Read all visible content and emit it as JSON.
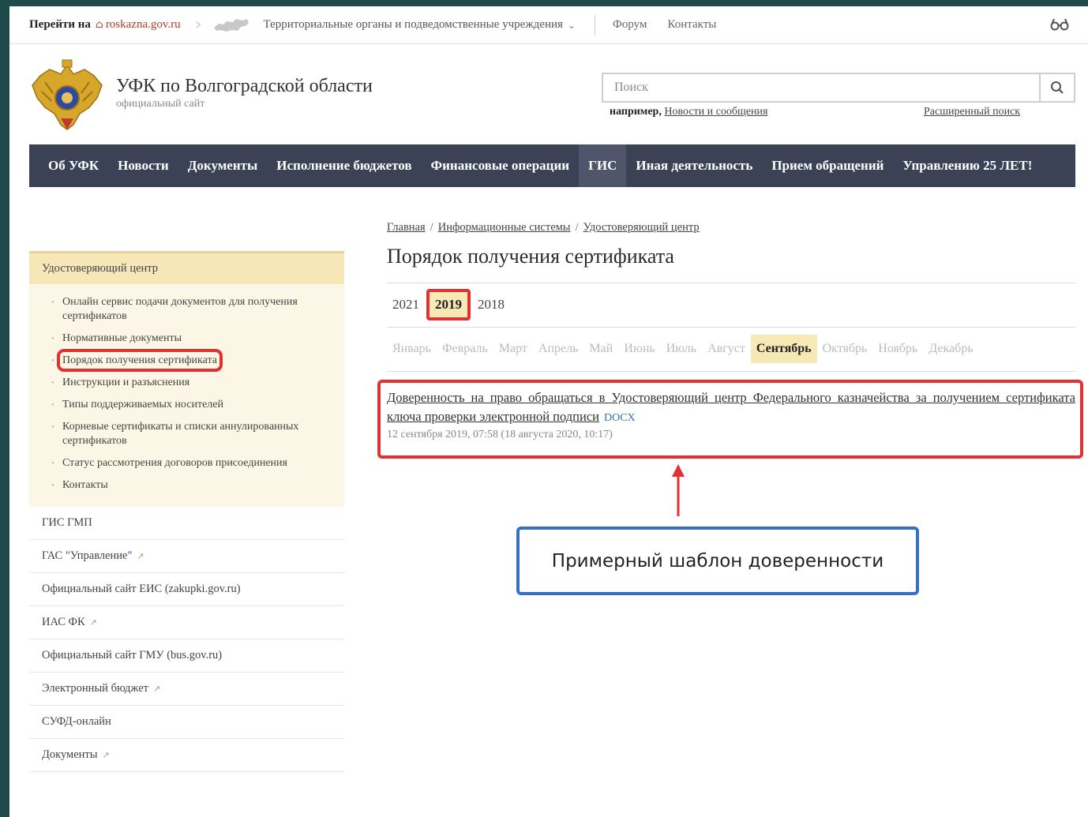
{
  "topbar": {
    "goto_label": "Перейти на",
    "roskazna": "roskazna.gov.ru",
    "territorial": "Территориальные органы и подведомственные учреждения",
    "forum": "Форум",
    "contacts": "Контакты",
    "icons": [
      "home-icon",
      "russia-map-icon",
      "chevron-down-icon",
      "glasses-icon"
    ]
  },
  "header": {
    "title": "УФК по Волгоградской области",
    "subtitle": "официальный сайт"
  },
  "search": {
    "placeholder": "Поиск",
    "example_prefix": "например,",
    "example_link": "Новости и сообщения",
    "advanced": "Расширенный поиск"
  },
  "nav": {
    "items": [
      "Об УФК",
      "Новости",
      "Документы",
      "Исполнение бюджетов",
      "Финансовые операции",
      "ГИС",
      "Иная деятельность",
      "Прием обращений",
      "Управлению 25 ЛЕТ!"
    ],
    "active": "ГИС"
  },
  "breadcrumb": [
    "Главная",
    "Информационные системы",
    "Удостоверяющий центр"
  ],
  "page_title": "Порядок получения сертификата",
  "years": [
    "2021",
    "2019",
    "2018"
  ],
  "active_year": "2019",
  "months": [
    "Январь",
    "Февраль",
    "Март",
    "Апрель",
    "Май",
    "Июнь",
    "Июль",
    "Август",
    "Сентябрь",
    "Октябрь",
    "Ноябрь",
    "Декабрь"
  ],
  "active_month": "Сентябрь",
  "document": {
    "title": "Доверенность на право обращаться в Удостоверяющий центр Федерального казначейства за получением сертификата ключа проверки электронной подписи",
    "filetype": "DOCX",
    "date": "12 сентября 2019, 07:58 (18 августа 2020, 10:17)"
  },
  "callout": "Примерный шаблон доверенности",
  "sidebar": {
    "section": "Удостоверяющий центр",
    "subitems": [
      "Онлайн сервис подачи документов для получения сертификатов",
      "Нормативные документы",
      "Порядок получения сертификата",
      "Инструкции и разъяснения",
      "Типы поддерживаемых носителей",
      "Корневые сертификаты и списки аннулированных сертификатов",
      "Статус рассмотрения договоров присоединения",
      "Контакты"
    ],
    "links": [
      "ГИС ГМП",
      "ГАС \"Управление\"",
      "Официальный сайт ЕИС (zakupki.gov.ru)",
      "ИАС ФК",
      "Официальный сайт ГМУ (bus.gov.ru)",
      "Электронный бюджет",
      "СУФД-онлайн",
      "Документы"
    ]
  },
  "colors": {
    "nav_bg": "#3b4256",
    "highlight": "#f7e9b5",
    "annotation_red": "#e03232",
    "annotation_blue": "#3a6fc0"
  }
}
